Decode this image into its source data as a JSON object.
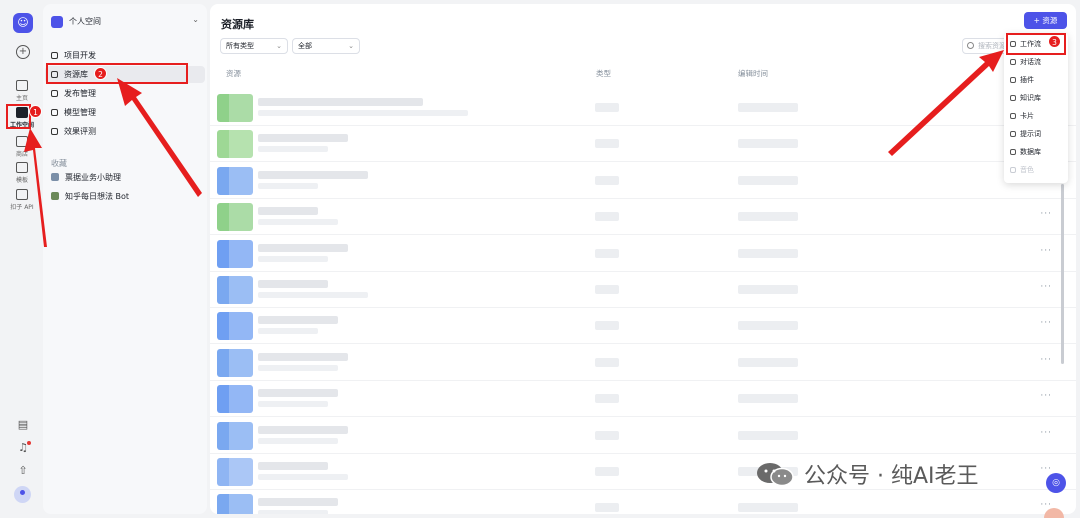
{
  "rail": {
    "items": [
      {
        "label": "主页",
        "icon": "home-icon"
      },
      {
        "label": "工作空间",
        "icon": "workspace-icon"
      },
      {
        "label": "商店",
        "icon": "store-icon"
      },
      {
        "label": "模板",
        "icon": "template-icon"
      },
      {
        "label": "扣子 API",
        "icon": "api-icon"
      }
    ]
  },
  "space": {
    "name": "个人空间"
  },
  "sidebar": {
    "items": [
      {
        "label": "项目开发",
        "icon": "project-icon"
      },
      {
        "label": "资源库",
        "icon": "library-icon"
      },
      {
        "label": "发布管理",
        "icon": "publish-icon"
      },
      {
        "label": "模型管理",
        "icon": "model-icon"
      },
      {
        "label": "效果评测",
        "icon": "evaluate-icon"
      }
    ],
    "favorites_title": "收藏",
    "favorites": [
      {
        "label": "票据业务小助理",
        "color": "#7b8fa8"
      },
      {
        "label": "知乎每日想法 Bot",
        "color": "#6c8a5a"
      }
    ]
  },
  "main": {
    "title": "资源库",
    "add_button": "+ 资源",
    "filters": [
      "所有类型",
      "全部"
    ],
    "search_placeholder": "搜索资源",
    "columns": [
      "资源",
      "类型",
      "编辑时间"
    ],
    "rows": [
      {
        "thumb": "#8fd18a"
      },
      {
        "thumb": "#9ed895"
      },
      {
        "thumb": "#7aa8f0"
      },
      {
        "thumb": "#8fd18a"
      },
      {
        "thumb": "#6f9ff2"
      },
      {
        "thumb": "#7aa8f0"
      },
      {
        "thumb": "#6f9ff2"
      },
      {
        "thumb": "#7aa8f0"
      },
      {
        "thumb": "#6f9ff2"
      },
      {
        "thumb": "#7aa8f0"
      },
      {
        "thumb": "#8fb5f3"
      },
      {
        "thumb": "#7aa8f0"
      }
    ]
  },
  "dropdown": {
    "items": [
      {
        "label": "工作流",
        "icon": "workflow-icon",
        "disabled": false
      },
      {
        "label": "对话流",
        "icon": "chatflow-icon",
        "disabled": false
      },
      {
        "label": "插件",
        "icon": "plugin-icon",
        "disabled": false
      },
      {
        "label": "知识库",
        "icon": "knowledge-icon",
        "disabled": false
      },
      {
        "label": "卡片",
        "icon": "card-icon",
        "disabled": false
      },
      {
        "label": "提示词",
        "icon": "prompt-icon",
        "disabled": false
      },
      {
        "label": "数据库",
        "icon": "database-icon",
        "disabled": false
      },
      {
        "label": "音色",
        "icon": "voice-icon",
        "disabled": true
      }
    ]
  },
  "annotations": {
    "badges": [
      "1",
      "2",
      "3"
    ],
    "color": "#e61e1e"
  },
  "watermark": {
    "text": "公众号 · 纯AI老王"
  },
  "colors": {
    "accent": "#4d53e8",
    "annotation": "#e61e1e"
  }
}
